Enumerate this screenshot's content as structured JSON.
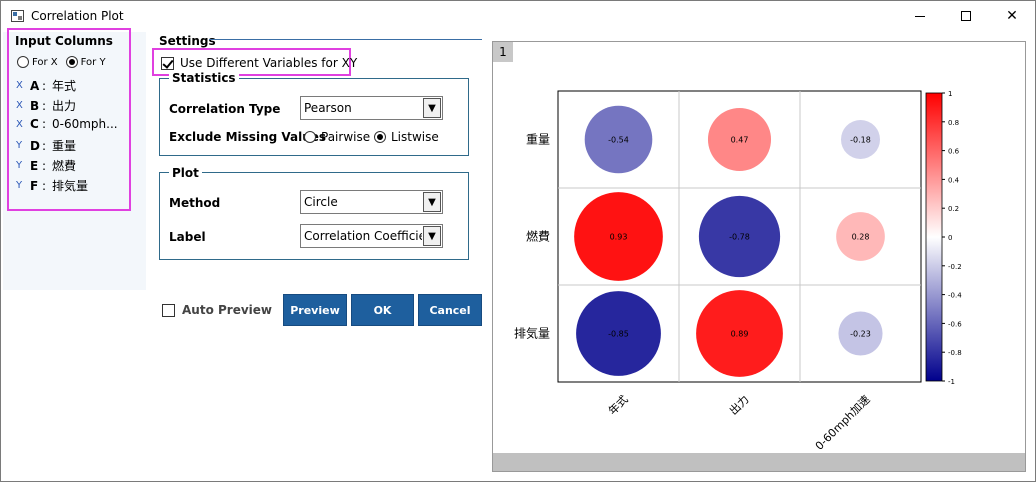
{
  "window": {
    "title": "Correlation Plot"
  },
  "input_columns": {
    "title": "Input Columns",
    "radio_x": "For X",
    "radio_y": "For Y",
    "columns": [
      {
        "role": "X",
        "letter": "A",
        "name": "年式"
      },
      {
        "role": "X",
        "letter": "B",
        "name": "出力"
      },
      {
        "role": "X",
        "letter": "C",
        "name": "0-60mph..."
      },
      {
        "role": "Y",
        "letter": "D",
        "name": "重量"
      },
      {
        "role": "Y",
        "letter": "E",
        "name": "燃費"
      },
      {
        "role": "Y",
        "letter": "F",
        "name": "排気量"
      }
    ],
    "separator": ":"
  },
  "settings": {
    "title": "Settings",
    "use_diff_vars": "Use Different Variables for XY",
    "statistics": {
      "title": "Statistics",
      "corr_type_label": "Correlation Type",
      "corr_type_value": "Pearson",
      "exclude_label": "Exclude Missing Values",
      "opt_pairwise": "Pairwise",
      "opt_listwise": "Listwise"
    },
    "plot": {
      "title": "Plot",
      "method_label": "Method",
      "method_value": "Circle",
      "label_label": "Label",
      "label_value": "Correlation Coefficient"
    }
  },
  "actions": {
    "auto_preview": "Auto Preview",
    "preview": "Preview",
    "ok": "OK",
    "cancel": "Cancel"
  },
  "preview": {
    "tab": "1"
  },
  "colors": {
    "accent_blue": "#1e5f9e",
    "highlight": "#e040e0",
    "positive": "#ff0000",
    "negative": "#0000a0"
  },
  "chart_data": {
    "type": "heatmap",
    "method": "circle",
    "x_labels": [
      "年式",
      "出力",
      "0-60mph加速"
    ],
    "y_labels": [
      "重量",
      "燃費",
      "排気量"
    ],
    "values": [
      [
        -0.54,
        0.47,
        -0.18
      ],
      [
        0.93,
        -0.78,
        0.28
      ],
      [
        -0.85,
        0.89,
        -0.23
      ]
    ],
    "cell_labels": [
      [
        "-0.54",
        "0.47",
        "-0.18"
      ],
      [
        "0.93",
        "-0.78",
        "0.28"
      ],
      [
        "-0.85",
        "0.89",
        "-0.23"
      ]
    ],
    "colorbar": {
      "range": [
        -1,
        1
      ],
      "ticks": [
        "1",
        "0.8",
        "0.6",
        "0.4",
        "0.2",
        "0",
        "-0.2",
        "-0.4",
        "-0.6",
        "-0.8",
        "-1"
      ],
      "tick_values": [
        1,
        0.8,
        0.6,
        0.4,
        0.2,
        0,
        -0.2,
        -0.4,
        -0.6,
        -0.8,
        -1
      ]
    },
    "grid": true
  }
}
